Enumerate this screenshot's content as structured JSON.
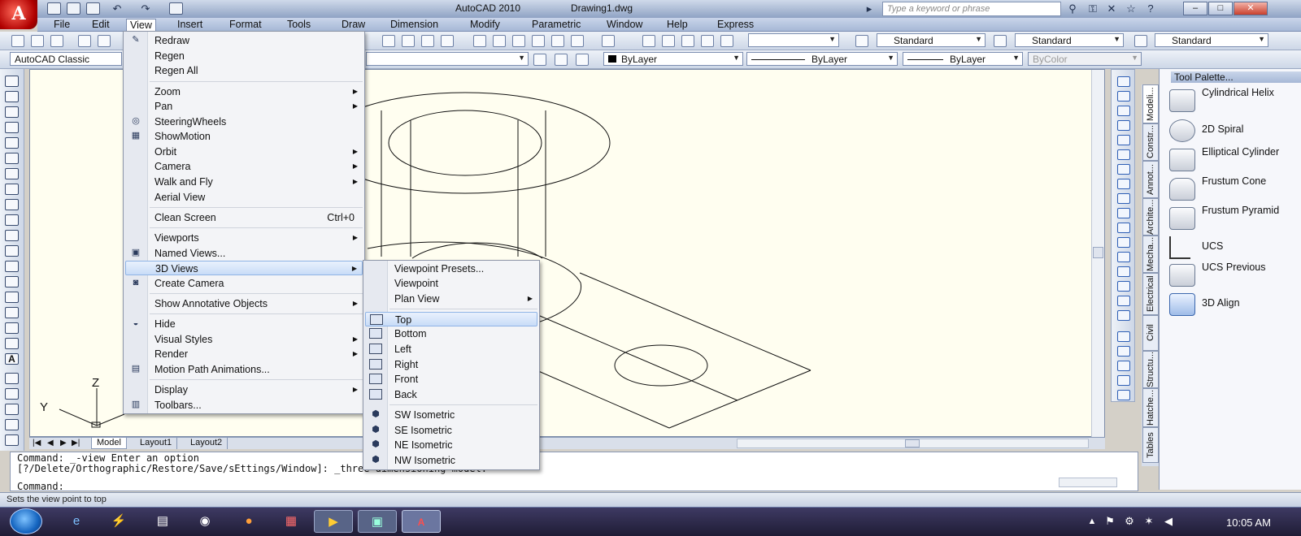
{
  "window": {
    "app_title": "AutoCAD 2010",
    "doc_title": "Drawing1.dwg",
    "search_placeholder": "Type a keyword or phrase"
  },
  "menubar": [
    "File",
    "Edit",
    "View",
    "Insert",
    "Format",
    "Tools",
    "Draw",
    "Dimension",
    "Modify",
    "Parametric",
    "Window",
    "Help",
    "Express"
  ],
  "toolbar": {
    "workspace": "AutoCAD Classic",
    "text_style": "Standard",
    "dim_style": "Standard",
    "table_style": "Standard",
    "color": "ByLayer",
    "linetype": "ByLayer",
    "lineweight": "ByLayer",
    "plotstyle": "ByColor"
  },
  "view_menu": {
    "items": [
      {
        "label": "Redraw",
        "icon": "brush-icon"
      },
      {
        "label": "Regen"
      },
      {
        "label": "Regen All"
      },
      {
        "label": "Zoom",
        "sub": true
      },
      {
        "label": "Pan",
        "sub": true
      },
      {
        "label": "SteeringWheels",
        "icon": "steering-wheel-icon"
      },
      {
        "label": "ShowMotion",
        "icon": "film-icon"
      },
      {
        "label": "Orbit",
        "sub": true
      },
      {
        "label": "Camera",
        "sub": true
      },
      {
        "label": "Walk and Fly",
        "sub": true
      },
      {
        "label": "Aerial View"
      },
      {
        "label": "Clean Screen",
        "shortcut": "Ctrl+0"
      },
      {
        "label": "Viewports",
        "sub": true
      },
      {
        "label": "Named Views...",
        "icon": "named-views-icon"
      },
      {
        "label": "3D Views",
        "sub": true,
        "active": true
      },
      {
        "label": "Create Camera",
        "icon": "camera-icon"
      },
      {
        "label": "Show Annotative Objects",
        "sub": true
      },
      {
        "label": "Hide",
        "icon": "hide-icon"
      },
      {
        "label": "Visual Styles",
        "sub": true
      },
      {
        "label": "Render",
        "sub": true
      },
      {
        "label": "Motion Path Animations...",
        "icon": "motion-path-icon"
      },
      {
        "label": "Display",
        "sub": true
      },
      {
        "label": "Toolbars...",
        "icon": "toolbars-icon"
      }
    ]
  },
  "views3d_menu": {
    "items": [
      {
        "label": "Viewpoint Presets..."
      },
      {
        "label": "Viewpoint"
      },
      {
        "label": "Plan View",
        "sub": true
      },
      {
        "label": "Top",
        "icon": "top-view-icon",
        "highlight": true
      },
      {
        "label": "Bottom",
        "icon": "bottom-view-icon"
      },
      {
        "label": "Left",
        "icon": "left-view-icon"
      },
      {
        "label": "Right",
        "icon": "right-view-icon"
      },
      {
        "label": "Front",
        "icon": "front-view-icon"
      },
      {
        "label": "Back",
        "icon": "back-view-icon"
      },
      {
        "label": "SW Isometric",
        "icon": "sw-iso-icon"
      },
      {
        "label": "SE Isometric",
        "icon": "se-iso-icon"
      },
      {
        "label": "NE Isometric",
        "icon": "ne-iso-icon"
      },
      {
        "label": "NW Isometric",
        "icon": "nw-iso-icon"
      }
    ]
  },
  "layout_tabs": [
    "Model",
    "Layout1",
    "Layout2"
  ],
  "ucs": {
    "z": "Z",
    "y": "Y"
  },
  "command": {
    "line1": "Command: _-view Enter an option",
    "line2": "[?/Delete/Orthographic/Restore/Save/sEttings/Window]: _three dimensioning model.",
    "prompt": "Command:"
  },
  "status_text": "Sets the view point to top",
  "palette": {
    "title": "Tool Palette...",
    "tabs": [
      "Modeli...",
      "Constr...",
      "Annot...",
      "Archite...",
      "Mecha...",
      "Electrical",
      "Civil",
      "Structu...",
      "Hatche...",
      "Tables"
    ],
    "tools": [
      {
        "label": "Cylindrical Helix",
        "icon": "helix-icon"
      },
      {
        "label": "2D Spiral",
        "icon": "spiral-icon"
      },
      {
        "label": "Elliptical Cylinder",
        "icon": "cylinder-icon"
      },
      {
        "label": "Frustum Cone",
        "icon": "frustum-cone-icon"
      },
      {
        "label": "Frustum Pyramid",
        "icon": "frustum-pyramid-icon"
      },
      {
        "label": "UCS",
        "icon": "ucs-icon"
      },
      {
        "label": "UCS Previous",
        "icon": "ucs-previous-icon"
      },
      {
        "label": "3D Align",
        "icon": "align-3d-icon"
      }
    ]
  },
  "clock": "10:05 AM"
}
